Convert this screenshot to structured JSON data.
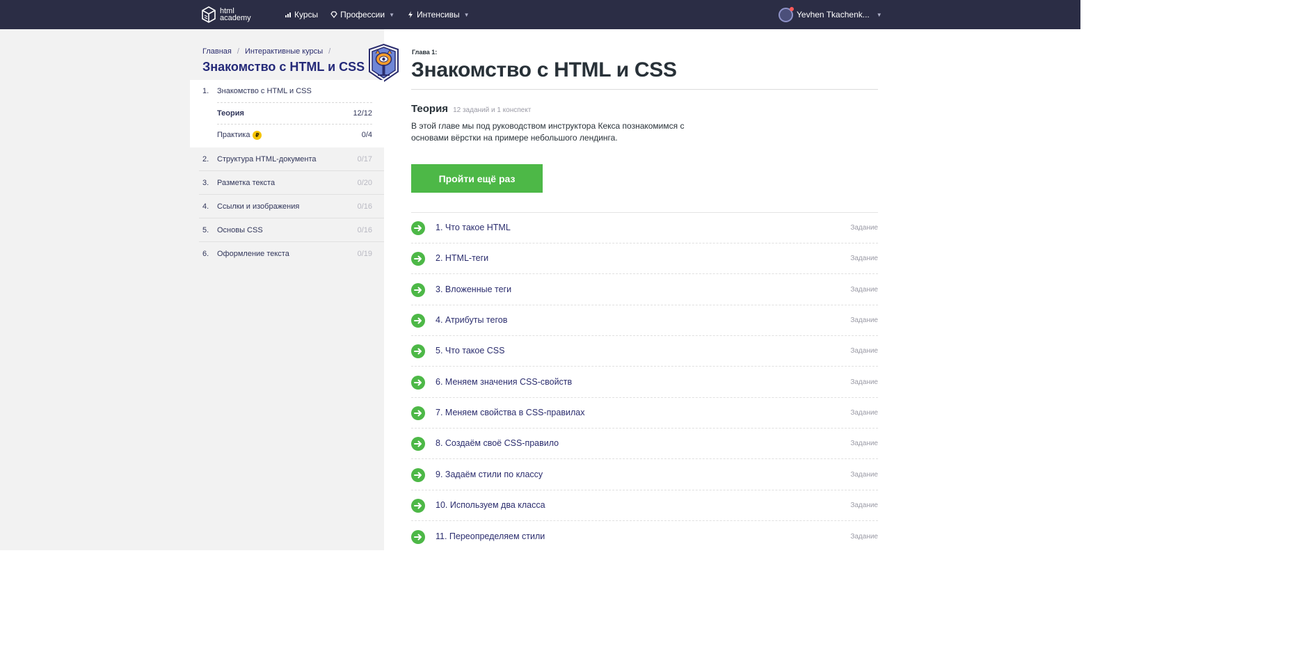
{
  "header": {
    "logo_line1": "html",
    "logo_line2": "academy",
    "nav": [
      {
        "label": "Курсы",
        "icon": "bars-icon",
        "has_caret": false
      },
      {
        "label": "Профессии",
        "icon": "diamond-icon",
        "has_caret": true
      },
      {
        "label": "Интенсивы",
        "icon": "lightning-icon",
        "has_caret": true
      }
    ],
    "user_name": "Yevhen Tkachenk..."
  },
  "sidebar": {
    "breadcrumbs": [
      "Главная",
      "Интерактивные курсы"
    ],
    "course_title": "Знакомство с HTML и CSS",
    "chapters": [
      {
        "num": "1.",
        "name": "Знакомство с HTML и CSS",
        "count": "",
        "active": true,
        "theory_label": "Теория",
        "theory_count": "12/12",
        "practice_label": "Практика",
        "practice_badge": "₽",
        "practice_count": "0/4"
      },
      {
        "num": "2.",
        "name": "Структура HTML-документа",
        "count": "0/17"
      },
      {
        "num": "3.",
        "name": "Разметка текста",
        "count": "0/20"
      },
      {
        "num": "4.",
        "name": "Ссылки и изображения",
        "count": "0/16"
      },
      {
        "num": "5.",
        "name": "Основы CSS",
        "count": "0/16"
      },
      {
        "num": "6.",
        "name": "Оформление текста",
        "count": "0/19"
      }
    ]
  },
  "main": {
    "chapter_label": "Глава 1:",
    "title": "Знакомство с HTML и CSS",
    "theory_title": "Теория",
    "theory_sub": "12 заданий и 1 конспект",
    "theory_desc": "В этой главе мы под руководством инструктора Кекса познакомимся с основами вёрстки на примере небольшого лендинга.",
    "retry_button": "Пройти ещё раз",
    "tasks": [
      {
        "name": "1. Что такое HTML",
        "type": "Задание"
      },
      {
        "name": "2. HTML-теги",
        "type": "Задание"
      },
      {
        "name": "3. Вложенные теги",
        "type": "Задание"
      },
      {
        "name": "4. Атрибуты тегов",
        "type": "Задание"
      },
      {
        "name": "5. Что такое CSS",
        "type": "Задание"
      },
      {
        "name": "6. Меняем значения CSS-свойств",
        "type": "Задание"
      },
      {
        "name": "7. Меняем свойства в CSS-правилах",
        "type": "Задание"
      },
      {
        "name": "8. Создаём своё CSS-правило",
        "type": "Задание"
      },
      {
        "name": "9. Задаём стили по классу",
        "type": "Задание"
      },
      {
        "name": "10. Используем два класса",
        "type": "Задание"
      },
      {
        "name": "11. Переопределяем стили",
        "type": "Задание"
      }
    ]
  },
  "colors": {
    "header_bg": "#2b2d45",
    "accent_green": "#4db847",
    "title_blue": "#252a79",
    "sidebar_bg": "#f2f2f2"
  }
}
